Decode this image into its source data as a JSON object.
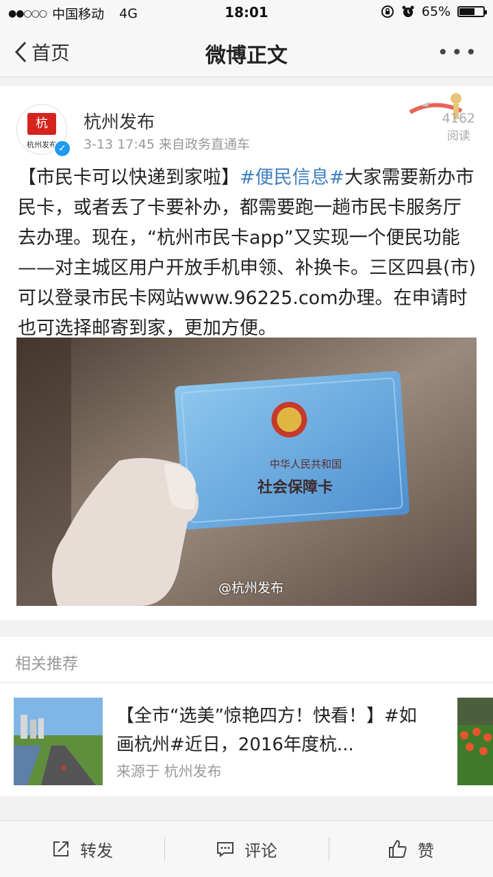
{
  "status_bar": {
    "signal": "●●○○○",
    "carrier": "中国移动",
    "network": "4G",
    "time": "18:01",
    "battery_percent": "65%",
    "battery_level": 0.65
  },
  "navbar": {
    "back_label": "首页",
    "title": "微博正文",
    "more_label": "•••"
  },
  "post": {
    "author": "杭州发布",
    "avatar_text": "杭州发布",
    "meta": "3-13 17:45  来自政务直通车",
    "read_count": "4162",
    "read_label": "阅读",
    "text_part1": "【市民卡可以快递到家啦】",
    "text_tag": "#便民信息#",
    "text_part2": "大家需要新办市民卡，或者丢了卡要补办，都需要跑一趟市民卡服务厅去办理。现在，“杭州市民卡app”又实现一个便民功能——对主城区用户开放手机申领、补换卡。三区四县(市)可以登录市民卡网站www.96225.com办理。在申请时也可选择邮寄到家，更加方便。",
    "card_line1": "中华人民共和国",
    "card_line2": "社会保障卡",
    "watermark": "@杭州发布"
  },
  "recommend": {
    "header": "相关推荐",
    "item_title": "【全市“选美”惊艳四方！快看！】#如画杭州#近日，2016年度杭...",
    "item_source": "来源于 杭州发布"
  },
  "bottom_bar": {
    "repost": "转发",
    "comment": "评论",
    "like": "赞"
  },
  "colors": {
    "link": "#3f7fc1",
    "verified": "#1e9bf0",
    "logo_red": "#d5231d"
  }
}
